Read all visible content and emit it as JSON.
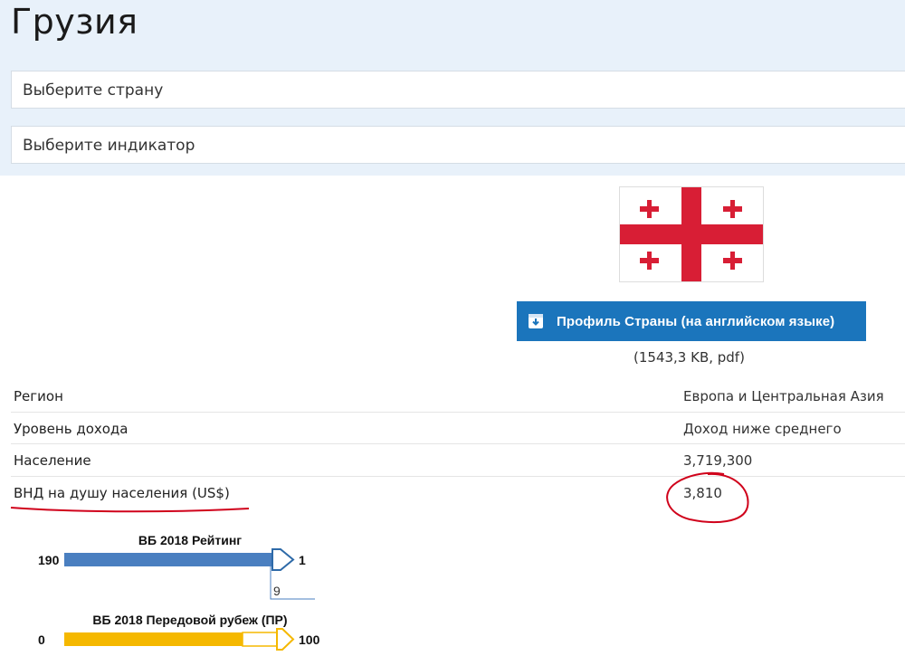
{
  "page": {
    "title": "Грузия"
  },
  "selectors": {
    "country_placeholder": "Выберите страну",
    "indicator_placeholder": "Выберите индикатор"
  },
  "profile": {
    "button_label": "Профиль Страны (на английском языке)",
    "file_info": "(1543,3 KB, pdf)",
    "icon": "download-icon"
  },
  "flag": {
    "icon": "georgia-flag",
    "colors": {
      "field": "#ffffff",
      "cross": "#d81e35"
    }
  },
  "info_rows": [
    {
      "label": "Регион",
      "value": "Европа и Центральная Азия"
    },
    {
      "label": "Уровень дохода",
      "value": "Доход ниже среднего"
    },
    {
      "label": "Население",
      "value": "3,719,300"
    },
    {
      "label": "ВНД на душу населения (US$)",
      "value": "3,810"
    }
  ],
  "rankings": {
    "rank_title": "ВБ 2018 Рейтинг",
    "rank_left": "190",
    "rank_right": "1",
    "rank_value": "9",
    "dtf_title": "ВБ 2018 Передовой рубеж (ПР)",
    "dtf_left": "0",
    "dtf_right": "100"
  },
  "colors": {
    "accent_blue": "#1b75bc",
    "panel_bg": "#e8f1fa",
    "rank_bar": "#4a7fc0",
    "dtf_bar": "#f5b800",
    "annotation_red": "#d0021b"
  }
}
